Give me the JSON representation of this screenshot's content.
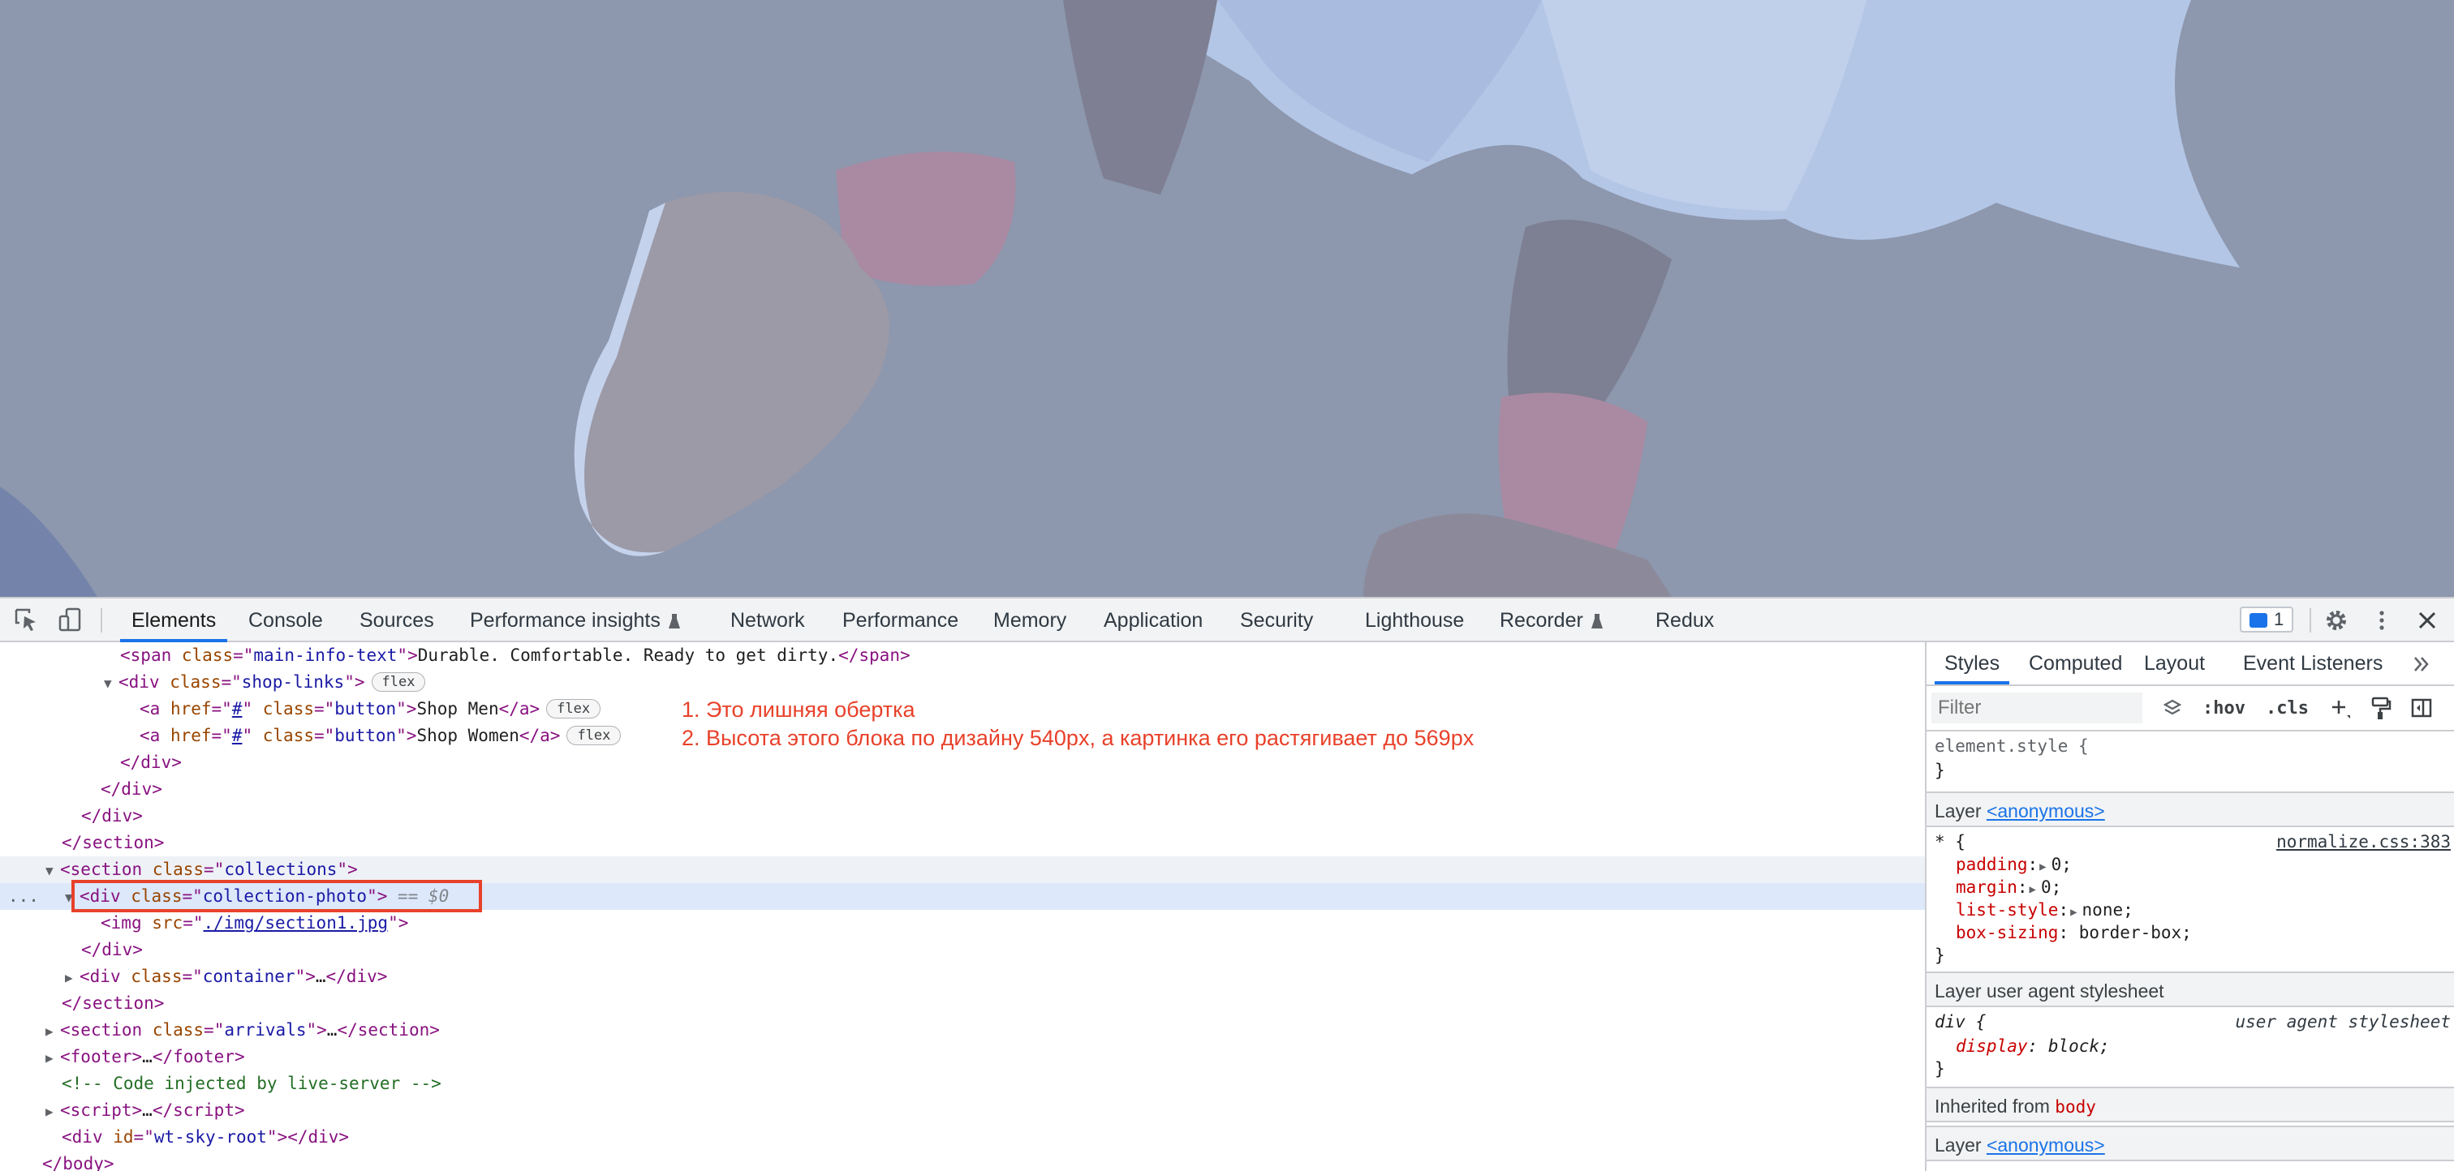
{
  "toolbar": {
    "tabs": [
      {
        "label": "Elements"
      },
      {
        "label": "Console"
      },
      {
        "label": "Sources"
      },
      {
        "label": "Performance insights"
      },
      {
        "label": "Network"
      },
      {
        "label": "Performance"
      },
      {
        "label": "Memory"
      },
      {
        "label": "Application"
      },
      {
        "label": "Security"
      },
      {
        "label": "Lighthouse"
      },
      {
        "label": "Recorder"
      },
      {
        "label": "Redux"
      }
    ],
    "issues_count": "1",
    "active_tab": "Elements"
  },
  "dom": {
    "l1": {
      "tag": "span",
      "attr": "class",
      "val": "main-info-text",
      "text": "Durable. Comfortable. Ready to get dirty.",
      "close": "span"
    },
    "l2": {
      "tag": "div",
      "attr": "class",
      "val": "shop-links",
      "badge": "flex"
    },
    "l3": {
      "href": "#",
      "val": "button",
      "text": "Shop Men",
      "badge": "flex"
    },
    "l4": {
      "href": "#",
      "val": "button",
      "text": "Shop Women",
      "badge": "flex"
    },
    "l5": "</div>",
    "l6": "</div>",
    "l7": "</div>",
    "l8": "</section>",
    "l9": {
      "tag": "section",
      "attr": "class",
      "val": "collections"
    },
    "l10": {
      "tag": "div",
      "attr": "class",
      "val": "collection-photo",
      "marker": "== $0"
    },
    "l11": {
      "tag": "img",
      "attr": "src",
      "val": "./img/section1.jpg"
    },
    "l12": "</div>",
    "l13": {
      "tag": "div",
      "attr": "class",
      "val": "container",
      "collapsed": "…"
    },
    "l14": "</section>",
    "l15": {
      "tag": "section",
      "attr": "class",
      "val": "arrivals",
      "collapsed": "…"
    },
    "l16": {
      "tag": "footer",
      "collapsed": "…"
    },
    "l17": "<!-- Code injected by live-server -->",
    "l18": {
      "tag": "script",
      "collapsed": "…"
    },
    "l19": {
      "tag": "div",
      "attr": "id",
      "val": "wt-sky-root"
    },
    "l20": "</body>",
    "ellipsis": "..."
  },
  "annotations": {
    "note1": "1. Это лишняя обертка",
    "note2": "2. Высота этого блока по дизайну 540px, а картинка его растягивает до 569px"
  },
  "sidebar": {
    "tabs": [
      "Styles",
      "Computed",
      "Layout",
      "Event Listeners"
    ],
    "active_tab": "Styles",
    "filter_placeholder": "Filter",
    "hov": ":hov",
    "cls": ".cls",
    "element_style": "element.style {",
    "close_brace": "}",
    "layer1": {
      "label": "Layer",
      "link": "<anonymous>"
    },
    "rule1": {
      "selector": "* {",
      "source": "normalize.css:383",
      "props": [
        {
          "name": "padding",
          "value": "0;",
          "expand": true
        },
        {
          "name": "margin",
          "value": "0;",
          "expand": true
        },
        {
          "name": "list-style",
          "value": "none;",
          "expand": true
        },
        {
          "name": "box-sizing",
          "value": "border-box;",
          "expand": false
        }
      ]
    },
    "layer2": {
      "label": "Layer user agent stylesheet"
    },
    "rule2": {
      "selector": "div {",
      "source": "user agent stylesheet",
      "props": [
        {
          "name": "display",
          "value": "block;"
        }
      ]
    },
    "inherited": {
      "label": "Inherited from",
      "tag": "body"
    },
    "layer3": {
      "label": "Layer",
      "link": "<anonymous>"
    }
  },
  "colors": {
    "accent": "#1a73e8",
    "annotation": "#e8412a",
    "overlay": "#8d97ad"
  }
}
